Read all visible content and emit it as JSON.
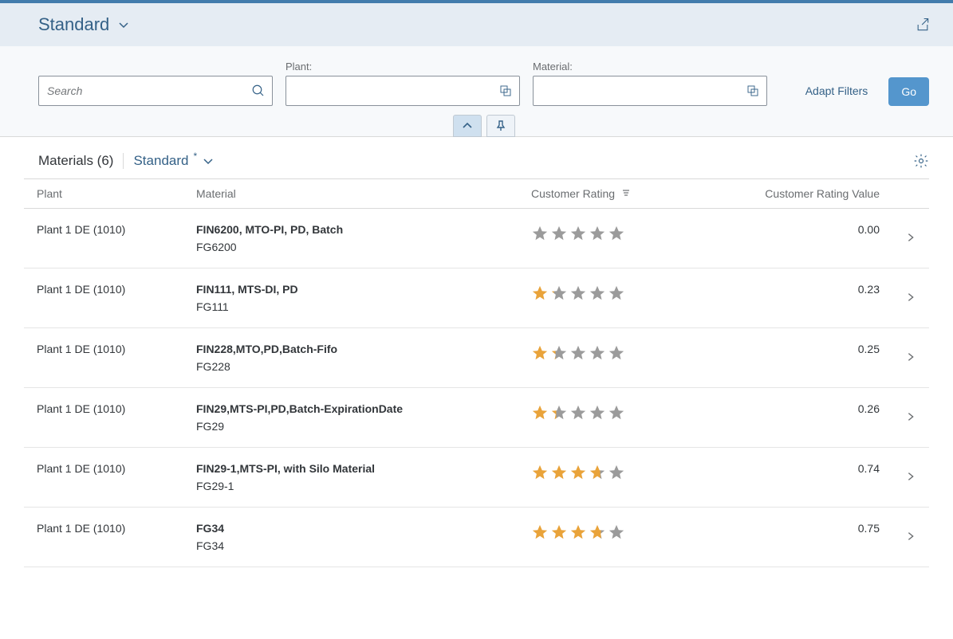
{
  "header": {
    "variant": "Standard"
  },
  "filters": {
    "search_placeholder": "Search",
    "plant_label": "Plant:",
    "material_label": "Material:",
    "adapt": "Adapt Filters",
    "go": "Go"
  },
  "table": {
    "title": "Materials (6)",
    "variant": "Standard",
    "columns": {
      "plant": "Plant",
      "material": "Material",
      "rating": "Customer Rating",
      "value": "Customer Rating Value"
    },
    "rows": [
      {
        "plant": "Plant 1 DE (1010)",
        "mat_name": "FIN6200, MTO-PI, PD, Batch",
        "mat_code": "FG6200",
        "rating": 0.0,
        "value": "0.00"
      },
      {
        "plant": "Plant 1 DE (1010)",
        "mat_name": "FIN111, MTS-DI, PD",
        "mat_code": "FG111",
        "rating": 0.23,
        "value": "0.23"
      },
      {
        "plant": "Plant 1 DE (1010)",
        "mat_name": "FIN228,MTO,PD,Batch-Fifo",
        "mat_code": "FG228",
        "rating": 0.25,
        "value": "0.25"
      },
      {
        "plant": "Plant 1 DE (1010)",
        "mat_name": "FIN29,MTS-PI,PD,Batch-ExpirationDate",
        "mat_code": "FG29",
        "rating": 0.26,
        "value": "0.26"
      },
      {
        "plant": "Plant 1 DE (1010)",
        "mat_name": "FIN29-1,MTS-PI, with Silo Material",
        "mat_code": "FG29-1",
        "rating": 0.74,
        "value": "0.74"
      },
      {
        "plant": "Plant 1 DE (1010)",
        "mat_name": "FG34",
        "mat_code": "FG34",
        "rating": 0.75,
        "value": "0.75"
      }
    ]
  }
}
